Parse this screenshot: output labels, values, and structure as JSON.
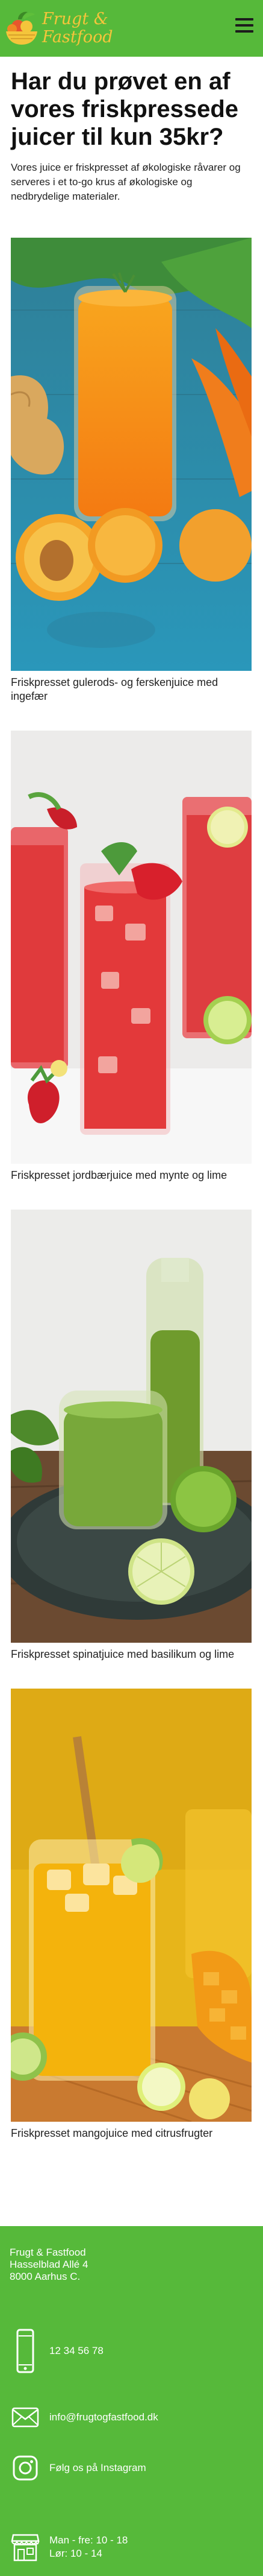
{
  "header": {
    "logo_line1": "Frugt &",
    "logo_line2": "Fastfood"
  },
  "main": {
    "title": "Har du prøvet en af vores friskpressede juicer til kun 35kr?",
    "intro": "Vores juice er friskpresset af økologiske råvarer og serveres i et to-go krus af økologiske og nedbrydelige materialer.",
    "juices": [
      {
        "caption": "Friskpresset gulerods- og ferskenjuice med ingefær"
      },
      {
        "caption": "Friskpresset jordbærjuice med mynte og lime"
      },
      {
        "caption": "Friskpresset spinatjuice med basilikum og lime"
      },
      {
        "caption": "Friskpresset mangojuice med citrusfrugter"
      }
    ]
  },
  "footer": {
    "company": "Frugt & Fastfood",
    "street": "Hasselblad Allé 4",
    "city": "8000 Aarhus C.",
    "phone": "12 34 56 78",
    "email": "info@frugtogfastfood.dk",
    "instagram": "Følg os på Instagram",
    "hours_line1": "Man - fre: 10 - 18",
    "hours_line2": "Lør: 10 - 14"
  },
  "colors": {
    "brand_green": "#56b93a",
    "logo_yellow": "#f4c53b"
  }
}
